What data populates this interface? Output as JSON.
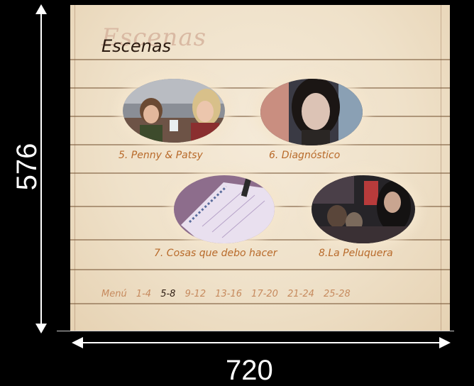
{
  "annotations": {
    "height_label": "576",
    "width_label": "720"
  },
  "menu": {
    "title": "Escenas",
    "scenes": [
      {
        "label": "5. Penny & Patsy"
      },
      {
        "label": "6. Diagnóstico"
      },
      {
        "label": "7. Cosas que debo hacer"
      },
      {
        "label": "8.La Peluquera"
      }
    ],
    "nav": {
      "home": "Menú",
      "pages": [
        "1-4",
        "5-8",
        "9-12",
        "13-16",
        "17-20",
        "21-24",
        "25-28"
      ],
      "active_page": "5-8"
    }
  },
  "colors": {
    "paper": "#efe1c9",
    "caption": "#b86a2a",
    "ink": "#2b1a10",
    "rule": "#7a5a3a"
  }
}
